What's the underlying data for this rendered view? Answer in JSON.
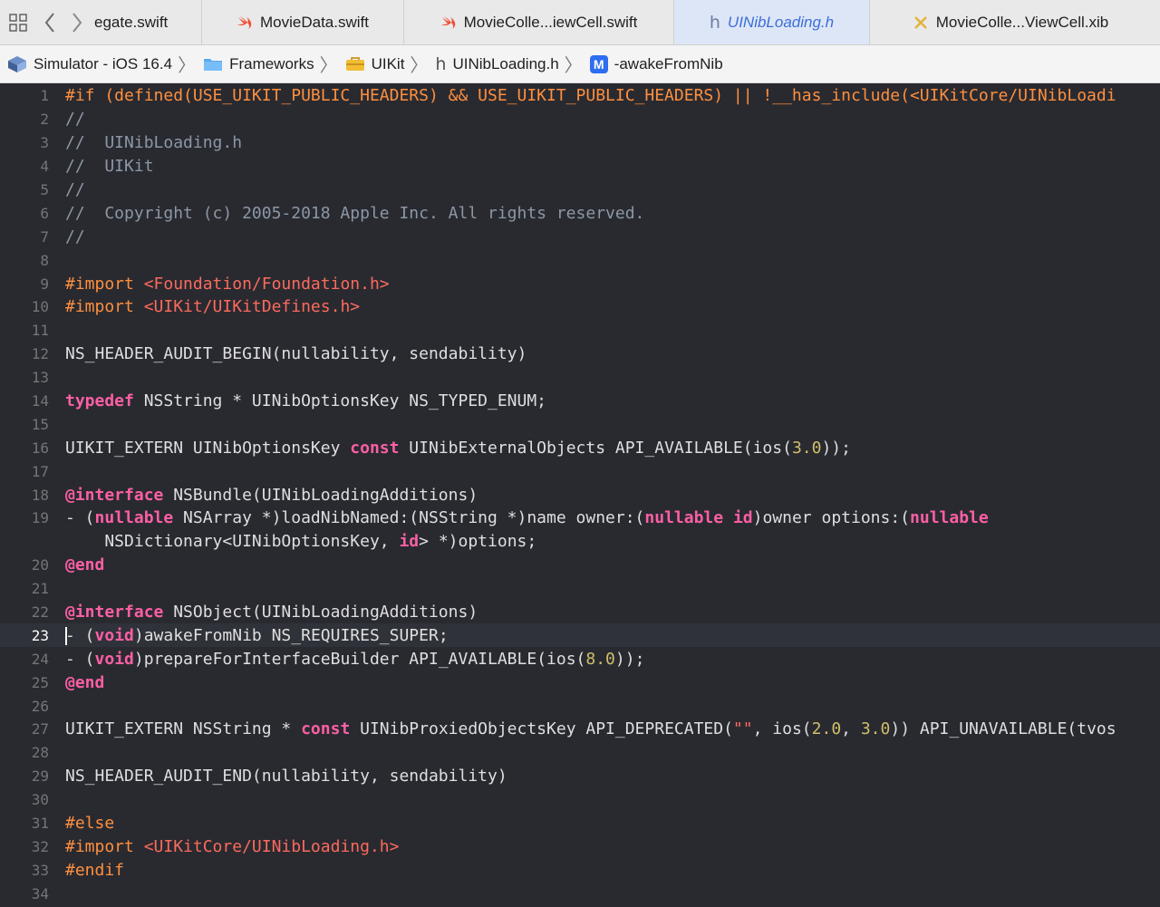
{
  "tabs": [
    {
      "label": "egate.swift",
      "icon": "none",
      "active": false
    },
    {
      "label": "MovieData.swift",
      "icon": "swift-icon",
      "active": false
    },
    {
      "label": "MovieColle...iewCell.swift",
      "icon": "swift-icon",
      "active": false
    },
    {
      "label": "UINibLoading.h",
      "icon": "header-file-icon",
      "active": true
    },
    {
      "label": "MovieColle...ViewCell.xib",
      "icon": "xib-icon",
      "active": false
    }
  ],
  "breadcrumb": {
    "simulator": "Simulator - iOS 16.4",
    "frameworks": "Frameworks",
    "uikit": "UIKit",
    "file": "UINibLoading.h",
    "method_badge": "M",
    "method": "-awakeFromNib"
  },
  "colors": {
    "editor_bg": "#292a30",
    "preprocessor": "#fd8f3f",
    "keyword": "#fc5fa3",
    "string": "#fc6a5d",
    "number": "#d0bf69",
    "comment": "#8c97a5",
    "text": "#dfdfe0",
    "active_tab": "#3c6ed8"
  },
  "editor": {
    "current_line": 23,
    "lines": [
      {
        "n": "1",
        "t": [
          [
            "pp",
            "#if (defined(USE_UIKIT_PUBLIC_HEADERS) && USE_UIKIT_PUBLIC_HEADERS) || !__has_include(<UIKitCore/UINibLoadi"
          ]
        ]
      },
      {
        "n": "2",
        "t": [
          [
            "cmt",
            "//"
          ]
        ]
      },
      {
        "n": "3",
        "t": [
          [
            "cmt",
            "//  UINibLoading.h"
          ]
        ]
      },
      {
        "n": "4",
        "t": [
          [
            "cmt",
            "//  UIKit"
          ]
        ]
      },
      {
        "n": "5",
        "t": [
          [
            "cmt",
            "//"
          ]
        ]
      },
      {
        "n": "6",
        "t": [
          [
            "cmt",
            "//  Copyright (c) 2005-2018 Apple Inc. All rights reserved."
          ]
        ]
      },
      {
        "n": "7",
        "t": [
          [
            "cmt",
            "//"
          ]
        ]
      },
      {
        "n": "8",
        "t": []
      },
      {
        "n": "9",
        "t": [
          [
            "pp",
            "#import "
          ],
          [
            "str",
            "<Foundation/Foundation.h>"
          ]
        ]
      },
      {
        "n": "10",
        "t": [
          [
            "pp",
            "#import "
          ],
          [
            "str",
            "<UIKit/UIKitDefines.h>"
          ]
        ]
      },
      {
        "n": "11",
        "t": []
      },
      {
        "n": "12",
        "t": [
          [
            "tx",
            "NS_HEADER_AUDIT_BEGIN(nullability, sendability)"
          ]
        ]
      },
      {
        "n": "13",
        "t": []
      },
      {
        "n": "14",
        "t": [
          [
            "kw",
            "typedef"
          ],
          [
            "tx",
            " NSString * UINibOptionsKey NS_TYPED_ENUM;"
          ]
        ]
      },
      {
        "n": "15",
        "t": []
      },
      {
        "n": "16",
        "t": [
          [
            "tx",
            "UIKIT_EXTERN UINibOptionsKey "
          ],
          [
            "kw",
            "const"
          ],
          [
            "tx",
            " UINibExternalObjects API_AVAILABLE(ios("
          ],
          [
            "num",
            "3.0"
          ],
          [
            "tx",
            "));"
          ]
        ]
      },
      {
        "n": "17",
        "t": []
      },
      {
        "n": "18",
        "t": [
          [
            "kw",
            "@interface"
          ],
          [
            "tx",
            " NSBundle(UINibLoadingAdditions)"
          ]
        ]
      },
      {
        "n": "19",
        "t": [
          [
            "tx",
            "- ("
          ],
          [
            "kw",
            "nullable"
          ],
          [
            "tx",
            " NSArray *)loadNibNamed:(NSString *)name owner:("
          ],
          [
            "kw",
            "nullable"
          ],
          [
            "tx",
            " "
          ],
          [
            "kw",
            "id"
          ],
          [
            "tx",
            ")owner options:("
          ],
          [
            "kw",
            "nullable"
          ]
        ]
      },
      {
        "n": "",
        "t": [
          [
            "tx",
            "    NSDictionary<UINibOptionsKey, "
          ],
          [
            "kw",
            "id"
          ],
          [
            "tx",
            "> *)options;"
          ]
        ]
      },
      {
        "n": "20",
        "t": [
          [
            "kw",
            "@end"
          ]
        ]
      },
      {
        "n": "21",
        "t": []
      },
      {
        "n": "22",
        "t": [
          [
            "kw",
            "@interface"
          ],
          [
            "tx",
            " NSObject(UINibLoadingAdditions)"
          ]
        ]
      },
      {
        "n": "23",
        "t": [
          [
            "cursor",
            ""
          ],
          [
            "tx",
            "- ("
          ],
          [
            "kw",
            "void"
          ],
          [
            "tx",
            ")awakeFromNib NS_REQUIRES_SUPER;"
          ]
        ]
      },
      {
        "n": "24",
        "t": [
          [
            "tx",
            "- ("
          ],
          [
            "kw",
            "void"
          ],
          [
            "tx",
            ")prepareForInterfaceBuilder API_AVAILABLE(ios("
          ],
          [
            "num",
            "8.0"
          ],
          [
            "tx",
            "));"
          ]
        ]
      },
      {
        "n": "25",
        "t": [
          [
            "kw",
            "@end"
          ]
        ]
      },
      {
        "n": "26",
        "t": []
      },
      {
        "n": "27",
        "t": [
          [
            "tx",
            "UIKIT_EXTERN NSString * "
          ],
          [
            "kw",
            "const"
          ],
          [
            "tx",
            " UINibProxiedObjectsKey API_DEPRECATED("
          ],
          [
            "str",
            "\"\""
          ],
          [
            "tx",
            ", ios("
          ],
          [
            "num",
            "2.0"
          ],
          [
            "tx",
            ", "
          ],
          [
            "num",
            "3.0"
          ],
          [
            "tx",
            ")) API_UNAVAILABLE(tvos"
          ]
        ]
      },
      {
        "n": "28",
        "t": []
      },
      {
        "n": "29",
        "t": [
          [
            "tx",
            "NS_HEADER_AUDIT_END(nullability, sendability)"
          ]
        ]
      },
      {
        "n": "30",
        "t": []
      },
      {
        "n": "31",
        "t": [
          [
            "pp",
            "#else"
          ]
        ]
      },
      {
        "n": "32",
        "t": [
          [
            "pp",
            "#import "
          ],
          [
            "str",
            "<UIKitCore/UINibLoading.h>"
          ]
        ]
      },
      {
        "n": "33",
        "t": [
          [
            "pp",
            "#endif"
          ]
        ]
      },
      {
        "n": "34",
        "t": []
      }
    ]
  }
}
